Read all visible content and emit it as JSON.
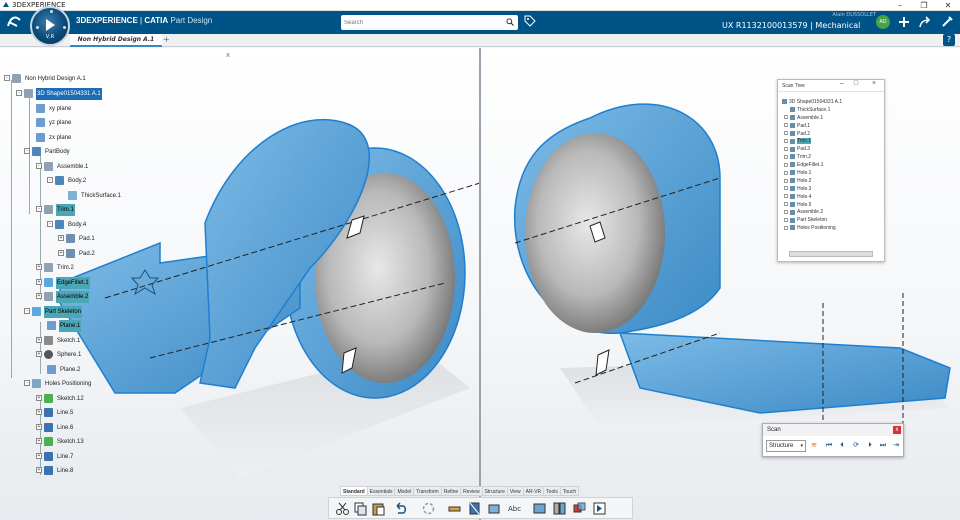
{
  "window": {
    "title": "3DEXPERIENCE",
    "controls": [
      "–",
      "❐",
      "✕"
    ]
  },
  "compass": {
    "label": "V,R"
  },
  "brand": {
    "name": "3DEXPERIENCE",
    "separator": " | ",
    "product": "CATIA",
    "app": "Part Design"
  },
  "search": {
    "placeholder": "Search"
  },
  "user": {
    "name": "Alain DUSSOLLET"
  },
  "workspace": {
    "label": "UX R1132100013579 | Mechanical ..."
  },
  "avatar": {
    "initials": "AD"
  },
  "tabs": [
    {
      "label": "Non Hybrid Design A.1"
    }
  ],
  "tab_add": "+",
  "tree_close": "x",
  "help": "?",
  "tree": [
    {
      "label": "Non Hybrid Design A.1"
    },
    {
      "label": "3D Shape01504331 A.1"
    },
    {
      "label": "xy plane"
    },
    {
      "label": "yz plane"
    },
    {
      "label": "zx plane"
    },
    {
      "label": "PartBody"
    },
    {
      "label": "Assemble.1"
    },
    {
      "label": "Body.2"
    },
    {
      "label": "ThickSurface.1"
    },
    {
      "label": "Trim.1"
    },
    {
      "label": "Body.4"
    },
    {
      "label": "Pad.1"
    },
    {
      "label": "Pad.2"
    },
    {
      "label": "Trim.2"
    },
    {
      "label": "EdgeFillet.1"
    },
    {
      "label": "Assemble.2"
    },
    {
      "label": "Part Skeleton"
    },
    {
      "label": "Plane.1"
    },
    {
      "label": "Sketch.1"
    },
    {
      "label": "Sphere.1"
    },
    {
      "label": "Plane.2"
    },
    {
      "label": "Holes Positioning"
    },
    {
      "label": "Sketch.12"
    },
    {
      "label": "Line.5"
    },
    {
      "label": "Line.6"
    },
    {
      "label": "Sketch.13"
    },
    {
      "label": "Line.7"
    },
    {
      "label": "Line.8"
    }
  ],
  "scan_tree": {
    "title": "Scan Tree",
    "items": [
      "3D Shape01504331 A.1",
      "ThickSurface.1",
      "Assemble.1",
      "Pad.1",
      "Pad.2",
      "Trim.1",
      "Pad.3",
      "Trim.2",
      "EdgeFillet.1",
      "Hole.1",
      "Hole.2",
      "Hole.3",
      "Hole.4",
      "Hole.5",
      "Assemble.2",
      "Part Skeleton",
      "Holes Positioning"
    ]
  },
  "scan": {
    "title": "Scan",
    "mode": "Structure",
    "close": "x"
  },
  "action_bar": {
    "sections": [
      "Standard",
      "Essentials",
      "Model",
      "Transform",
      "Refine",
      "Review",
      "Structure",
      "View",
      "AR-VR",
      "Tools",
      "Touch"
    ],
    "active": "Standard"
  },
  "colors": {
    "topbar": "#005386",
    "selection": "#1c6db5",
    "highlight": "#4ba6b6",
    "model_blue": "#5aa9dc"
  }
}
